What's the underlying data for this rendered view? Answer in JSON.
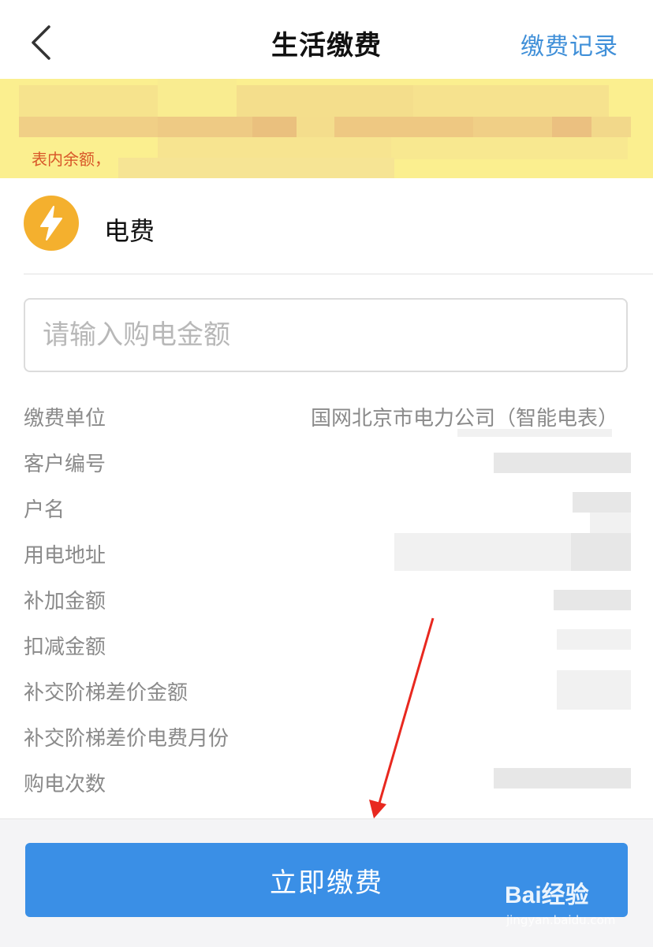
{
  "header": {
    "title": "生活缴费",
    "record_link": "缴费记录"
  },
  "notice": {
    "visible_text": "表内余额，"
  },
  "service": {
    "name": "电费",
    "icon": "lightning-icon",
    "icon_color": "#f4b02e"
  },
  "amount_input": {
    "placeholder": "请输入购电金额",
    "value": ""
  },
  "info": {
    "rows": [
      {
        "label": "缴费单位",
        "value": "国网北京市电力公司（智能电表）"
      },
      {
        "label": "客户编号"
      },
      {
        "label": "户名"
      },
      {
        "label": "用电地址"
      },
      {
        "label": "补加金额"
      },
      {
        "label": "扣减金额"
      },
      {
        "label": "补交阶梯差价金额"
      },
      {
        "label": "补交阶梯差价电费月份"
      },
      {
        "label": "购电次数"
      }
    ]
  },
  "footer": {
    "pay_button": "立即缴费"
  },
  "watermark": {
    "text": "Bai经验",
    "url": "jingyan.baidu.com"
  },
  "colors": {
    "accent": "#3a8fe6",
    "link": "#3f8fd8",
    "notice_bg": "#fbef8f",
    "annotation_arrow": "#e8281f"
  }
}
